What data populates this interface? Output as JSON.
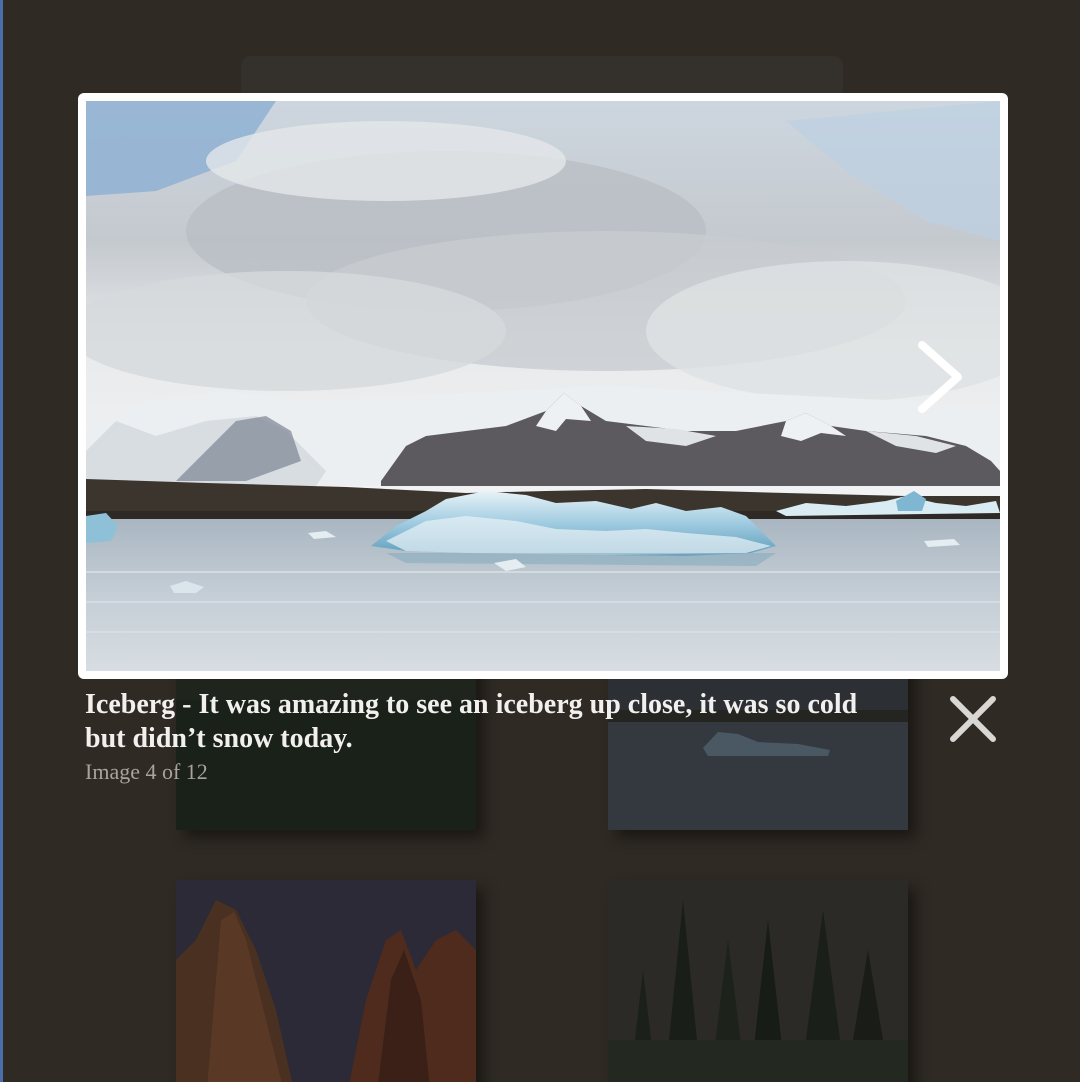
{
  "lightbox": {
    "caption_title": "Iceberg - It was amazing to see an iceberg up close, it was so cold but didn’t snow today.",
    "counter": "Image 4 of 12",
    "image_alt": "Iceberg",
    "next_icon": "chevron-right-icon",
    "close_icon": "close-icon"
  },
  "gallery": {
    "thumbnails": [
      {
        "alt": "field"
      },
      {
        "alt": "iceberg lagoon"
      },
      {
        "alt": "red rock canyon"
      },
      {
        "alt": "pine trees"
      }
    ]
  },
  "colors": {
    "background": "#2f2a24",
    "frame": "#ffffff",
    "caption_title": "#f2f0ee",
    "caption_counter": "#a8a39c"
  }
}
